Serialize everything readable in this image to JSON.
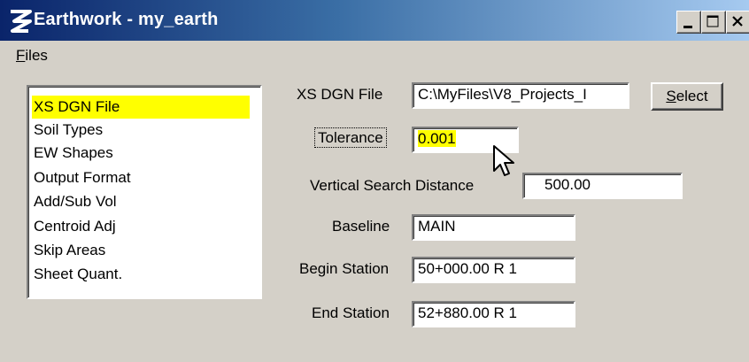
{
  "window": {
    "title": "Earthwork - my_earth"
  },
  "menu": {
    "files_prefix": "F",
    "files_rest": "iles"
  },
  "list": {
    "items": [
      {
        "label": "XS DGN File",
        "selected": true
      },
      {
        "label": "Soil Types"
      },
      {
        "label": "EW Shapes"
      },
      {
        "label": "Output Format"
      },
      {
        "label": "Add/Sub Vol"
      },
      {
        "label": "Centroid Adj"
      },
      {
        "label": "Skip Areas"
      },
      {
        "label": "Sheet Quant."
      }
    ]
  },
  "form": {
    "xs_dgn_file": {
      "label": "XS DGN File",
      "value": "C:\\MyFiles\\V8_Projects_I"
    },
    "select_button": {
      "prefix": "S",
      "rest": "elect"
    },
    "tolerance": {
      "label": "Tolerance",
      "value": "0.001"
    },
    "vertical_search": {
      "label": "Vertical Search Distance",
      "value": "500.00"
    },
    "baseline": {
      "label": "Baseline",
      "value": "MAIN"
    },
    "begin_station": {
      "label": "Begin Station",
      "value": "50+000.00 R 1"
    },
    "end_station": {
      "label": "End Station",
      "value": "52+880.00 R 1"
    }
  },
  "colors": {
    "highlight": "#ffff00",
    "title_dark": "#0a246a",
    "title_light": "#a6caf0"
  }
}
